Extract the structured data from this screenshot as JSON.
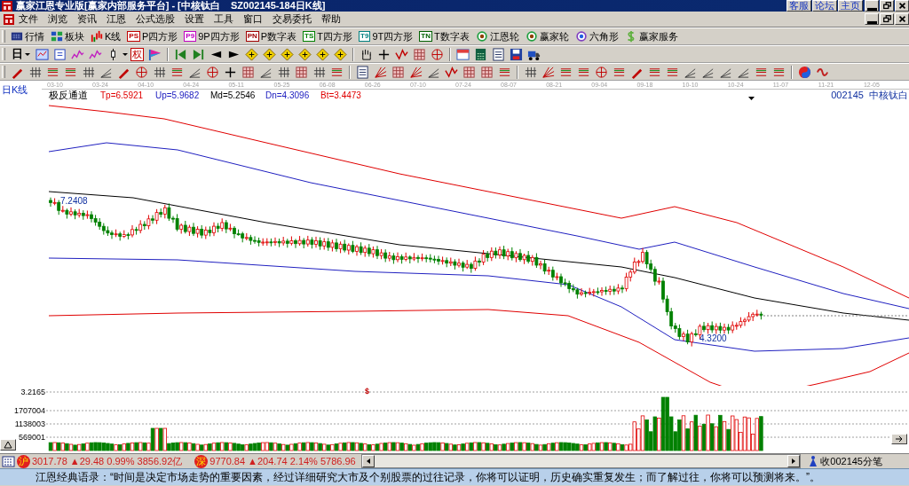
{
  "window": {
    "title": "赢家江恩专业版[赢家内部服务平台] - [中核钛白    SZ002145-184日K线]",
    "links": [
      "客服",
      "论坛",
      "主页"
    ]
  },
  "menu": [
    "文件",
    "浏览",
    "资讯",
    "江恩",
    "公式选股",
    "设置",
    "工具",
    "窗口",
    "交易委托",
    "帮助"
  ],
  "toolbar": [
    {
      "label": "行情",
      "kind": "screen"
    },
    {
      "label": "板块",
      "kind": "blocks"
    },
    {
      "label": "K线",
      "kind": "candles"
    },
    {
      "label": "P四方形",
      "kind": "badge",
      "badge": "PS",
      "color": "#c00000"
    },
    {
      "label": "9P四方形",
      "kind": "badge",
      "badge": "P9",
      "color": "#c000c0"
    },
    {
      "label": "P数字表",
      "kind": "badge",
      "badge": "PN",
      "color": "#a00000"
    },
    {
      "label": "T四方形",
      "kind": "badge",
      "badge": "TS",
      "color": "#008000"
    },
    {
      "label": "9T四方形",
      "kind": "badge",
      "badge": "T9",
      "color": "#008080"
    },
    {
      "label": "T数字表",
      "kind": "badge",
      "badge": "TN",
      "color": "#006000"
    },
    {
      "label": "江恩轮",
      "kind": "wheel"
    },
    {
      "label": "赢家轮",
      "kind": "wheel"
    },
    {
      "label": "六角形",
      "kind": "hexagon"
    },
    {
      "label": "赢家服务",
      "kind": "dollar"
    }
  ],
  "period": "日",
  "rights_badge": "权",
  "chart": {
    "title": "日K线",
    "dates": [
      "03-10",
      "03-24",
      "04-10",
      "04-24",
      "05-11",
      "05-25",
      "06-08",
      "06-26",
      "07-10",
      "07-24",
      "08-07",
      "08-21",
      "09-04",
      "09-18",
      "10-10",
      "10-24",
      "11-07",
      "11-21",
      "12-05"
    ],
    "indicator": "极反通道",
    "lines": [
      {
        "text": "Tp=6.5921",
        "color": "#e00000"
      },
      {
        "text": "Up=5.9682",
        "color": "#2020c0"
      },
      {
        "text": "Md=5.2546",
        "color": "#000000"
      },
      {
        "text": "Dn=4.3096",
        "color": "#2020c0"
      },
      {
        "text": "Bt=3.4473",
        "color": "#e00000"
      }
    ],
    "symbol": "002145  中核钛白",
    "high_label": "7.2408",
    "low_label": "4.3200"
  },
  "volume": {
    "ticks": [
      "3.2165",
      "1707004",
      "1138003",
      "569001"
    ],
    "marker": "$"
  },
  "status": {
    "indices": [
      {
        "badge": "沪",
        "text": "3017.78 ▲29.48 0.99% 3856.92亿"
      },
      {
        "badge": "深",
        "text": "9770.84 ▲204.74 2.14% 5786.96"
      }
    ],
    "tick_label": "收002145分笔"
  },
  "quote": "江恩经典语录：“时间是决定市场走势的重要因素，经过详细研究大市及个别股票的过往记录，你将可以证明，历史确实重复发生；而了解过往，你将可以预测将来。”。"
}
